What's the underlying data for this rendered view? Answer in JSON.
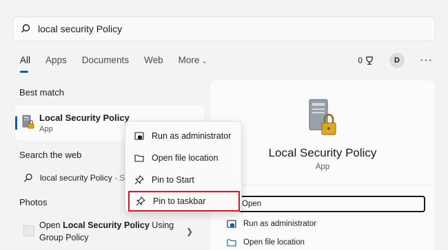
{
  "search": {
    "query": "local security Policy"
  },
  "tabs": [
    {
      "label": "All"
    },
    {
      "label": "Apps"
    },
    {
      "label": "Documents"
    },
    {
      "label": "Web"
    },
    {
      "label": "More"
    }
  ],
  "header_tools": {
    "points": "0",
    "avatar_initial": "D",
    "more_glyph": "···"
  },
  "sections": {
    "best_match": "Best match",
    "search_web": "Search the web",
    "photos": "Photos"
  },
  "best_match": {
    "title": "Local Security Policy",
    "subtitle": "App"
  },
  "web_result": {
    "query": "local security Policy",
    "suffix": "- See"
  },
  "photo_result": {
    "line1_prefix": "Open ",
    "line1_bold": "Local Security Policy",
    "line1_suffix": " Using",
    "line2": "Group Policy"
  },
  "context_menu": {
    "items": [
      {
        "label": "Run as administrator",
        "icon": "shield-icon"
      },
      {
        "label": "Open file location",
        "icon": "folder-icon"
      },
      {
        "label": "Pin to Start",
        "icon": "pin-icon"
      },
      {
        "label": "Pin to taskbar",
        "icon": "pin-icon"
      }
    ]
  },
  "preview": {
    "title": "Local Security Policy",
    "subtitle": "App",
    "actions": [
      {
        "label": "Open",
        "icon": "open-icon"
      },
      {
        "label": "Run as administrator",
        "icon": "shield-icon"
      },
      {
        "label": "Open file location",
        "icon": "folder-icon"
      }
    ]
  },
  "colors": {
    "accent": "#005fb8",
    "highlight_border": "#d7151b",
    "background": "#f3f3f3"
  }
}
